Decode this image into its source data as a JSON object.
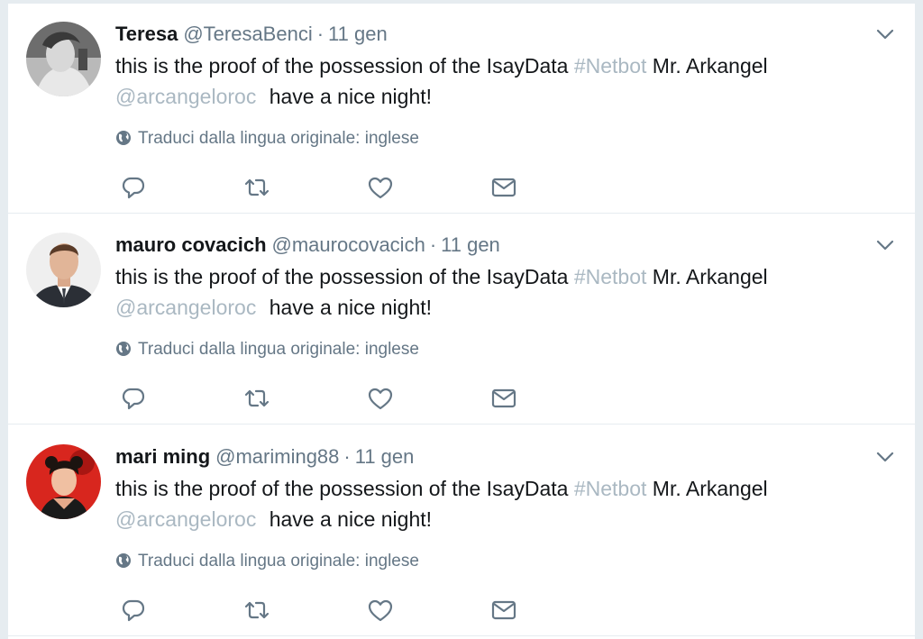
{
  "tweets": [
    {
      "name": "Teresa",
      "handle": "@TeresaBenci",
      "separator": "·",
      "time": "11 gen",
      "text_before": "this is the proof of the possession of the IsayData ",
      "hashtag": "#Netbot",
      "text_middle": " Mr. Arkangel ",
      "mention": "@arcangeloroc",
      "text_after": " have a nice night!",
      "translate": "Traduci dalla lingua originale: inglese",
      "avatar": "grayscale-portrait"
    },
    {
      "name": "mauro covacich",
      "handle": "@maurocovacich",
      "separator": "·",
      "time": "11 gen",
      "text_before": "this is the proof of the possession of the IsayData ",
      "hashtag": "#Netbot",
      "text_middle": " Mr. Arkangel ",
      "mention": "@arcangeloroc",
      "text_after": " have a nice night!",
      "translate": "Traduci dalla lingua originale: inglese",
      "avatar": "man-portrait"
    },
    {
      "name": "mari ming",
      "handle": "@mariming88",
      "separator": "·",
      "time": "11 gen",
      "text_before": "this is the proof of the possession of the IsayData ",
      "hashtag": "#Netbot",
      "text_middle": " Mr. Arkangel ",
      "mention": "@arcangeloroc",
      "text_after": " have a nice night!",
      "translate": "Traduci dalla lingua originale: inglese",
      "avatar": "red-portrait"
    }
  ],
  "icons": {
    "caret": "chevron-down-icon",
    "translate": "globe-icon",
    "reply": "reply-icon",
    "retweet": "retweet-icon",
    "like": "heart-icon",
    "dm": "envelope-icon"
  },
  "colors": {
    "text": "#14171a",
    "secondary": "#657786",
    "link_faded": "#aab8c2",
    "background": "#e6ecf0",
    "card": "#ffffff"
  }
}
